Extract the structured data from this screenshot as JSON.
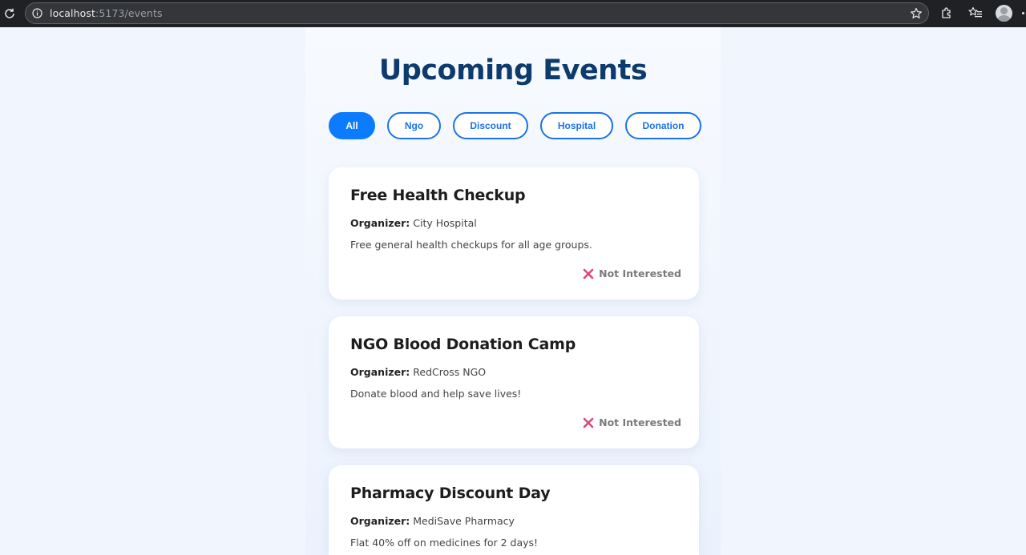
{
  "browser": {
    "url_host": "localhost",
    "url_rest": ":5173/events",
    "icons": [
      "reload-icon",
      "info-icon",
      "star-icon",
      "extensions-icon",
      "favorites-icon",
      "profile-avatar",
      "more-icon"
    ]
  },
  "page": {
    "title": "Upcoming Events",
    "filters": [
      {
        "label": "All",
        "active": true
      },
      {
        "label": "Ngo",
        "active": false
      },
      {
        "label": "Discount",
        "active": false
      },
      {
        "label": "Hospital",
        "active": false
      },
      {
        "label": "Donation",
        "active": false
      }
    ],
    "organizer_label": "Organizer:",
    "not_interested_label": "Not Interested",
    "events": [
      {
        "title": "Free Health Checkup",
        "organizer": "City Hospital",
        "description": "Free general health checkups for all age groups."
      },
      {
        "title": "NGO Blood Donation Camp",
        "organizer": "RedCross NGO",
        "description": "Donate blood and help save lives!"
      },
      {
        "title": "Pharmacy Discount Day",
        "organizer": "MediSave Pharmacy",
        "description": "Flat 40% off on medicines for 2 days!"
      }
    ]
  },
  "colors": {
    "title": "#0d3b6e",
    "accent": "#0b7bff",
    "not_interested_icon": "#e0457b"
  }
}
